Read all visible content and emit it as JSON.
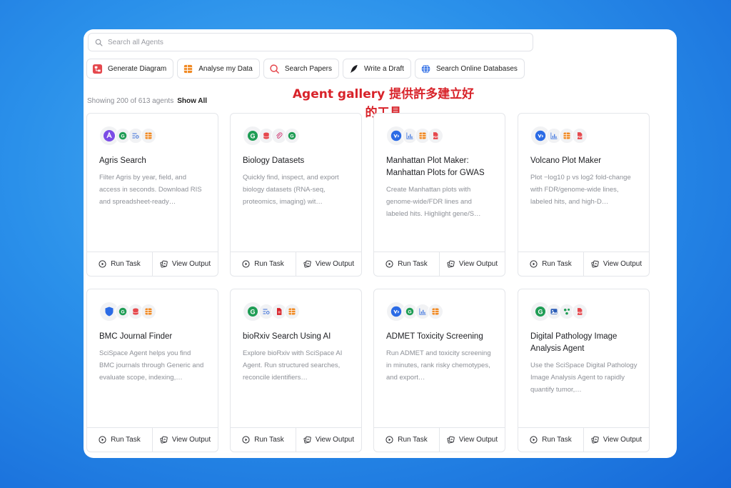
{
  "search": {
    "placeholder": "Search all Agents"
  },
  "quick_actions": [
    {
      "label": "Generate Diagram",
      "icon": "diagram-icon",
      "color": "#e5484d"
    },
    {
      "label": "Analyse my Data",
      "icon": "spreadsheet-icon",
      "color": "#f08a24"
    },
    {
      "label": "Search Papers",
      "icon": "search-icon",
      "color": "#e5484d"
    },
    {
      "label": "Write a Draft",
      "icon": "quill-icon",
      "color": "#1d1e22"
    },
    {
      "label": "Search Online Databases",
      "icon": "globe-icon",
      "color": "#2b6be5"
    }
  ],
  "listing": {
    "showing_text": "Showing 200 of 613 agents",
    "show_all_label": "Show All"
  },
  "annotation": {
    "line1": "Agent gallery 提供許多建立好",
    "line2": "的工具",
    "color": "#d8232a"
  },
  "card_actions": {
    "run_label": "Run Task",
    "view_label": "View Output"
  },
  "agents": [
    {
      "title": "Agris Search",
      "description": "Filter Agris by year, field, and access in seconds. Download RIS and spreadsheet-ready…",
      "icons": [
        "agris-logo-icon",
        "google-scholar-icon",
        "data-query-icon",
        "spreadsheet-icon"
      ]
    },
    {
      "title": "Biology Datasets",
      "description": "Quickly find, inspect, and export biology datasets (RNA-seq, proteomics, imaging) wit…",
      "icons": [
        "google-scholar-icon",
        "database-icon",
        "paperclip-icon",
        "google-scholar-icon"
      ]
    },
    {
      "title": "Manhattan Plot Maker: Manhattan Plots for GWAS",
      "description": "Create Manhattan plots with genome-wide/FDR lines and labeled hits. Highlight gene/S…",
      "icons": [
        "python-code-icon",
        "chart-icon",
        "spreadsheet-icon",
        "pdf-icon"
      ]
    },
    {
      "title": "Volcano Plot Maker",
      "description": "Plot −log10 p vs log2 fold-change with FDR/genome-wide lines, labeled hits, and high-D…",
      "icons": [
        "python-code-icon",
        "chart-icon",
        "spreadsheet-icon",
        "pdf-icon"
      ]
    },
    {
      "title": "BMC Journal Finder",
      "description": "SciSpace Agent helps you find BMC journals through Generic and evaluate scope, indexing,…",
      "icons": [
        "shield-icon",
        "google-scholar-icon",
        "database-icon",
        "spreadsheet-icon"
      ]
    },
    {
      "title": "bioRxiv Search Using AI",
      "description": "Explore bioRxiv with SciSpace AI Agent. Run structured searches, reconcile identifiers…",
      "icons": [
        "google-scholar-icon",
        "data-query-icon",
        "document-icon",
        "spreadsheet-icon"
      ]
    },
    {
      "title": "ADMET Toxicity Screening",
      "description": "Run ADMET and toxicity screening in minutes, rank risky chemotypes, and export…",
      "icons": [
        "python-code-icon",
        "google-scholar-icon",
        "chart-icon",
        "spreadsheet-icon"
      ]
    },
    {
      "title": "Digital Pathology Image Analysis Agent",
      "description": "Use the SciSpace Digital Pathology Image Analysis Agent to rapidly quantify tumor,…",
      "icons": [
        "google-scholar-icon",
        "image-icon",
        "molecule-icon",
        "pdf-icon"
      ]
    }
  ]
}
